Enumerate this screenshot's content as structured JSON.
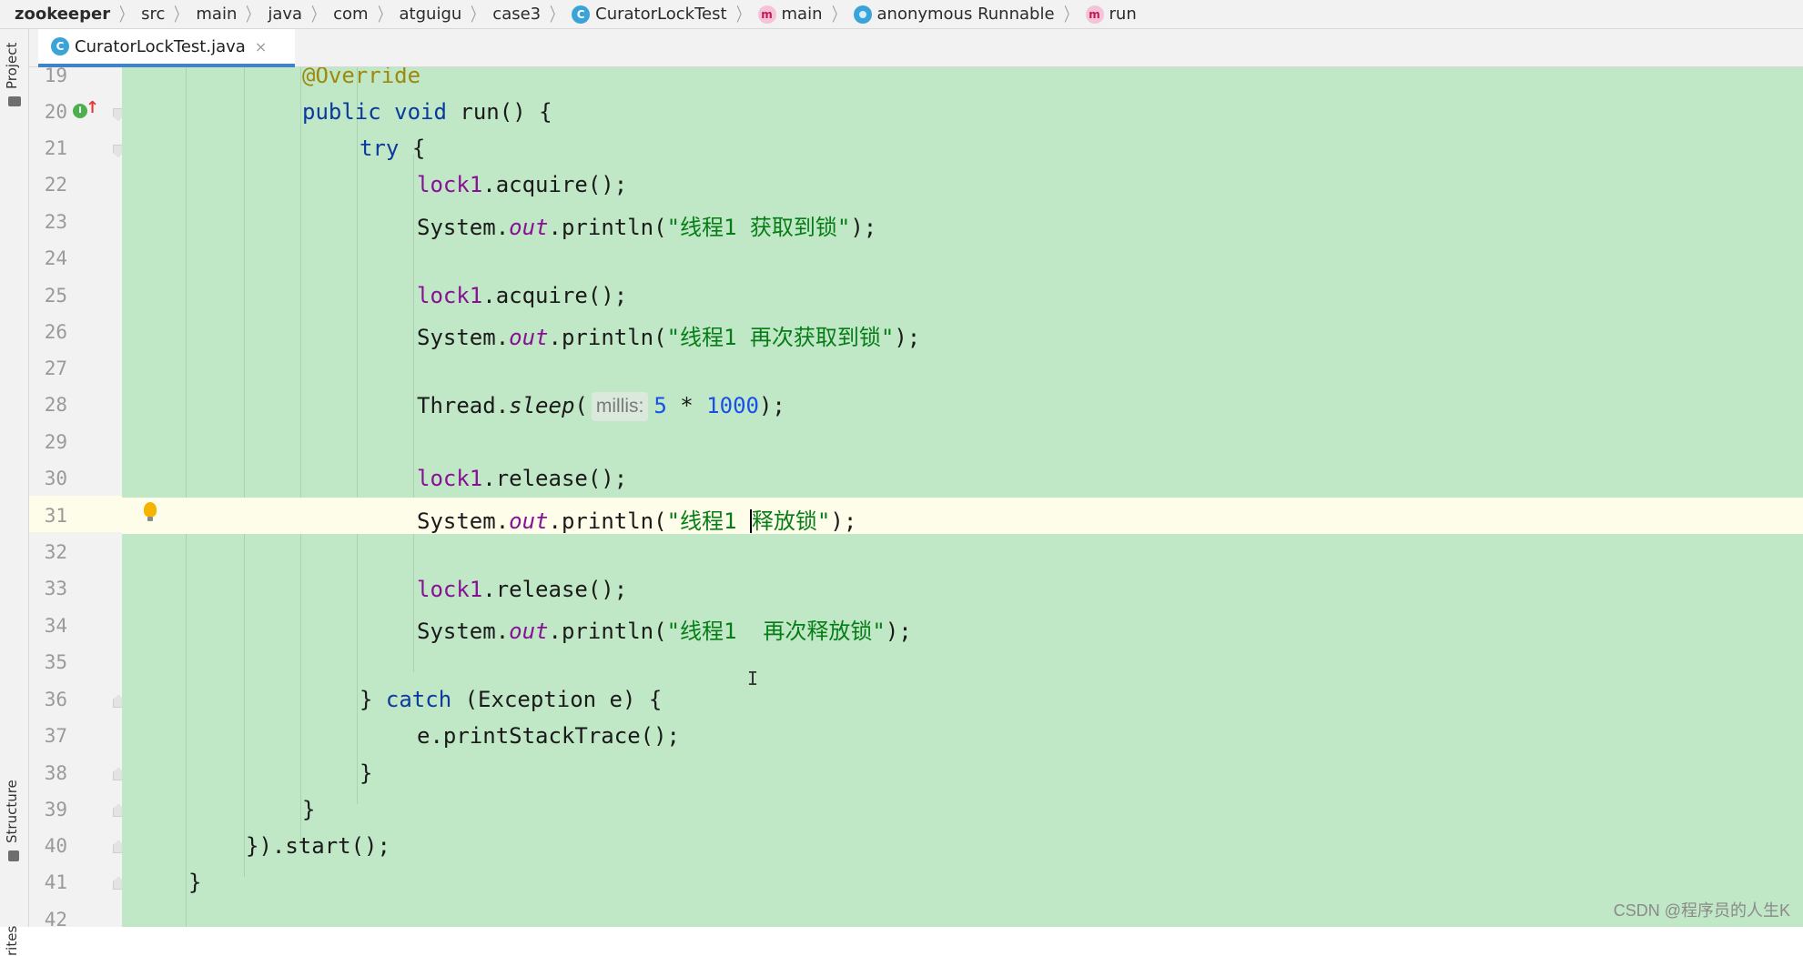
{
  "breadcrumb": [
    {
      "label": "zookeeper",
      "icon": "",
      "bold": true
    },
    {
      "label": "src",
      "icon": ""
    },
    {
      "label": "main",
      "icon": ""
    },
    {
      "label": "java",
      "icon": ""
    },
    {
      "label": "com",
      "icon": ""
    },
    {
      "label": "atguigu",
      "icon": ""
    },
    {
      "label": "case3",
      "icon": ""
    },
    {
      "label": "CuratorLockTest",
      "icon": "class-icon"
    },
    {
      "label": "main",
      "icon": "method-icon"
    },
    {
      "label": "anonymous Runnable",
      "icon": "anonymous-class-icon"
    },
    {
      "label": "run",
      "icon": "method-icon"
    }
  ],
  "sidebar": {
    "project_label": "Project",
    "structure_label": "Structure",
    "favorites_label": "rites"
  },
  "tab": {
    "title": "CuratorLockTest.java",
    "close": "×",
    "icon": "class-icon"
  },
  "editor": {
    "line_numbers": [
      "19",
      "20",
      "21",
      "22",
      "23",
      "24",
      "25",
      "26",
      "27",
      "28",
      "29",
      "30",
      "31",
      "32",
      "33",
      "34",
      "35",
      "36",
      "37",
      "38",
      "39",
      "40",
      "41",
      "42"
    ],
    "current_line": "31",
    "lines": {
      "l19": {
        "ann": "@Override"
      },
      "l20": {
        "kw1": "public",
        "kw2": "void",
        "rest": "run() {"
      },
      "l21": {
        "kw": "try",
        "rest": "{"
      },
      "l22": {
        "field": "lock1",
        "rest": ".acquire();"
      },
      "l23": {
        "cls": "System.",
        "out": "out",
        "mid": ".println(",
        "str": "\"线程1 获取到锁\"",
        "end": ");"
      },
      "l25": {
        "field": "lock1",
        "rest": ".acquire();"
      },
      "l26": {
        "cls": "System.",
        "out": "out",
        "mid": ".println(",
        "str": "\"线程1 再次获取到锁\"",
        "end": ");"
      },
      "l28": {
        "cls": "Thread.",
        "method": "sleep",
        "open": "(",
        "hint": "millis:",
        "n1": "5",
        "op": " * ",
        "n2": "1000",
        "end": ");"
      },
      "l30": {
        "field": "lock1",
        "rest": ".release();"
      },
      "l31": {
        "cls": "System.",
        "out": "out",
        "mid": ".println(",
        "str_a": "\"线程1 ",
        "str_b": "释放锁\"",
        "end": ");"
      },
      "l33": {
        "field": "lock1",
        "rest": ".release();"
      },
      "l34": {
        "cls": "System.",
        "out": "out",
        "mid": ".println(",
        "str": "\"线程1  再次释放锁\"",
        "end": ");"
      },
      "l36": {
        "a": "} ",
        "kw": "catch",
        "rest": " (Exception e) {"
      },
      "l37": {
        "text": "e.printStackTrace();"
      },
      "l38": {
        "text": "}"
      },
      "l39": {
        "text": "}"
      },
      "l40": {
        "text": "}).start();"
      },
      "l41": {
        "text": "}"
      }
    }
  },
  "watermark": "CSDN @程序员的人生K",
  "colors": {
    "editor_bg": "#c0e7c6",
    "current_line_bg": "#fdfde9",
    "keyword": "#0b3a9d",
    "string": "#067d17",
    "number": "#1750eb",
    "field": "#871094",
    "annotation": "#9e880d",
    "tab_underline": "#4083c9"
  }
}
